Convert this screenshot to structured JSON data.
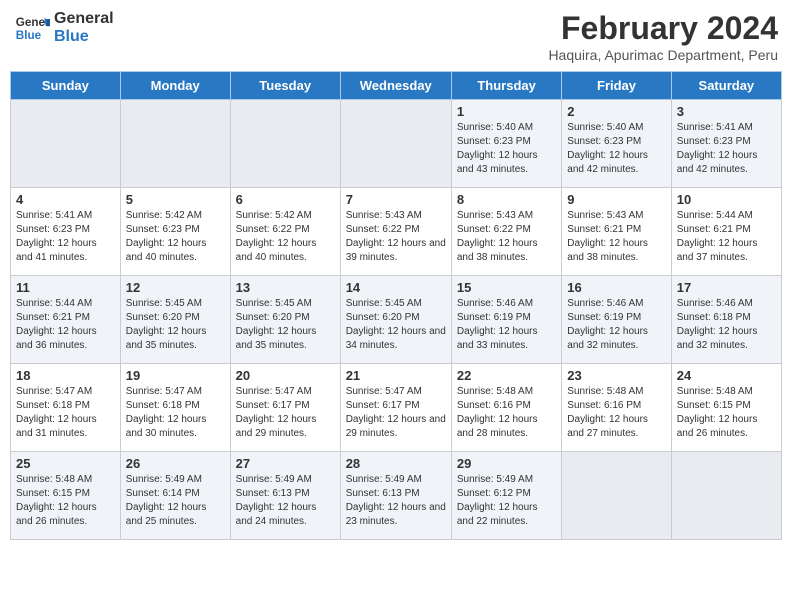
{
  "logo": {
    "line1": "General",
    "line2": "Blue"
  },
  "title": "February 2024",
  "subtitle": "Haquira, Apurimac Department, Peru",
  "days_of_week": [
    "Sunday",
    "Monday",
    "Tuesday",
    "Wednesday",
    "Thursday",
    "Friday",
    "Saturday"
  ],
  "weeks": [
    [
      {
        "day": "",
        "info": ""
      },
      {
        "day": "",
        "info": ""
      },
      {
        "day": "",
        "info": ""
      },
      {
        "day": "",
        "info": ""
      },
      {
        "day": "1",
        "info": "Sunrise: 5:40 AM\nSunset: 6:23 PM\nDaylight: 12 hours\nand 43 minutes."
      },
      {
        "day": "2",
        "info": "Sunrise: 5:40 AM\nSunset: 6:23 PM\nDaylight: 12 hours\nand 42 minutes."
      },
      {
        "day": "3",
        "info": "Sunrise: 5:41 AM\nSunset: 6:23 PM\nDaylight: 12 hours\nand 42 minutes."
      }
    ],
    [
      {
        "day": "4",
        "info": "Sunrise: 5:41 AM\nSunset: 6:23 PM\nDaylight: 12 hours\nand 41 minutes."
      },
      {
        "day": "5",
        "info": "Sunrise: 5:42 AM\nSunset: 6:23 PM\nDaylight: 12 hours\nand 40 minutes."
      },
      {
        "day": "6",
        "info": "Sunrise: 5:42 AM\nSunset: 6:22 PM\nDaylight: 12 hours\nand 40 minutes."
      },
      {
        "day": "7",
        "info": "Sunrise: 5:43 AM\nSunset: 6:22 PM\nDaylight: 12 hours\nand 39 minutes."
      },
      {
        "day": "8",
        "info": "Sunrise: 5:43 AM\nSunset: 6:22 PM\nDaylight: 12 hours\nand 38 minutes."
      },
      {
        "day": "9",
        "info": "Sunrise: 5:43 AM\nSunset: 6:21 PM\nDaylight: 12 hours\nand 38 minutes."
      },
      {
        "day": "10",
        "info": "Sunrise: 5:44 AM\nSunset: 6:21 PM\nDaylight: 12 hours\nand 37 minutes."
      }
    ],
    [
      {
        "day": "11",
        "info": "Sunrise: 5:44 AM\nSunset: 6:21 PM\nDaylight: 12 hours\nand 36 minutes."
      },
      {
        "day": "12",
        "info": "Sunrise: 5:45 AM\nSunset: 6:20 PM\nDaylight: 12 hours\nand 35 minutes."
      },
      {
        "day": "13",
        "info": "Sunrise: 5:45 AM\nSunset: 6:20 PM\nDaylight: 12 hours\nand 35 minutes."
      },
      {
        "day": "14",
        "info": "Sunrise: 5:45 AM\nSunset: 6:20 PM\nDaylight: 12 hours\nand 34 minutes."
      },
      {
        "day": "15",
        "info": "Sunrise: 5:46 AM\nSunset: 6:19 PM\nDaylight: 12 hours\nand 33 minutes."
      },
      {
        "day": "16",
        "info": "Sunrise: 5:46 AM\nSunset: 6:19 PM\nDaylight: 12 hours\nand 32 minutes."
      },
      {
        "day": "17",
        "info": "Sunrise: 5:46 AM\nSunset: 6:18 PM\nDaylight: 12 hours\nand 32 minutes."
      }
    ],
    [
      {
        "day": "18",
        "info": "Sunrise: 5:47 AM\nSunset: 6:18 PM\nDaylight: 12 hours\nand 31 minutes."
      },
      {
        "day": "19",
        "info": "Sunrise: 5:47 AM\nSunset: 6:18 PM\nDaylight: 12 hours\nand 30 minutes."
      },
      {
        "day": "20",
        "info": "Sunrise: 5:47 AM\nSunset: 6:17 PM\nDaylight: 12 hours\nand 29 minutes."
      },
      {
        "day": "21",
        "info": "Sunrise: 5:47 AM\nSunset: 6:17 PM\nDaylight: 12 hours\nand 29 minutes."
      },
      {
        "day": "22",
        "info": "Sunrise: 5:48 AM\nSunset: 6:16 PM\nDaylight: 12 hours\nand 28 minutes."
      },
      {
        "day": "23",
        "info": "Sunrise: 5:48 AM\nSunset: 6:16 PM\nDaylight: 12 hours\nand 27 minutes."
      },
      {
        "day": "24",
        "info": "Sunrise: 5:48 AM\nSunset: 6:15 PM\nDaylight: 12 hours\nand 26 minutes."
      }
    ],
    [
      {
        "day": "25",
        "info": "Sunrise: 5:48 AM\nSunset: 6:15 PM\nDaylight: 12 hours\nand 26 minutes."
      },
      {
        "day": "26",
        "info": "Sunrise: 5:49 AM\nSunset: 6:14 PM\nDaylight: 12 hours\nand 25 minutes."
      },
      {
        "day": "27",
        "info": "Sunrise: 5:49 AM\nSunset: 6:13 PM\nDaylight: 12 hours\nand 24 minutes."
      },
      {
        "day": "28",
        "info": "Sunrise: 5:49 AM\nSunset: 6:13 PM\nDaylight: 12 hours\nand 23 minutes."
      },
      {
        "day": "29",
        "info": "Sunrise: 5:49 AM\nSunset: 6:12 PM\nDaylight: 12 hours\nand 22 minutes."
      },
      {
        "day": "",
        "info": ""
      },
      {
        "day": "",
        "info": ""
      }
    ]
  ]
}
